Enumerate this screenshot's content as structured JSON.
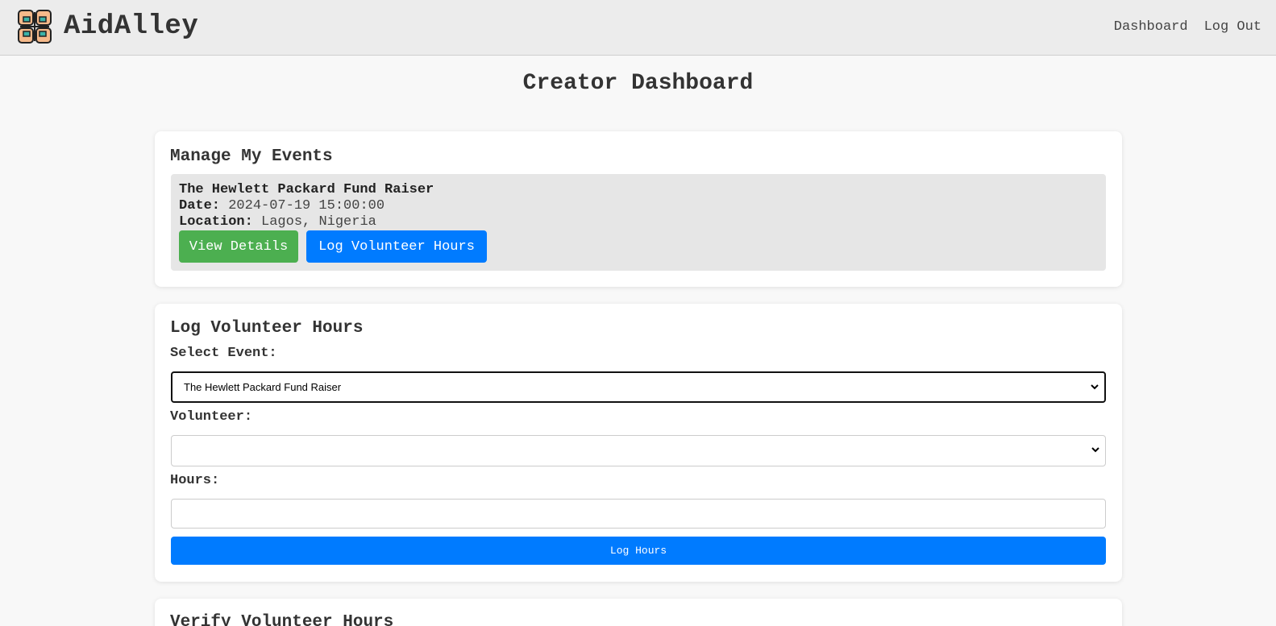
{
  "header": {
    "brand": "AidAlley",
    "nav": [
      {
        "label": "Dashboard"
      },
      {
        "label": "Log Out"
      }
    ]
  },
  "page_title": "Creator Dashboard",
  "manage_events": {
    "title": "Manage My Events",
    "event": {
      "name": "The Hewlett Packard Fund Raiser",
      "date_label": "Date:",
      "date": "2024-07-19 15:00:00",
      "location_label": "Location:",
      "location": "Lagos, Nigeria",
      "view_details": "View Details",
      "log_hours": "Log Volunteer Hours"
    }
  },
  "log_hours_form": {
    "title": "Log Volunteer Hours",
    "event_label": "Select Event:",
    "event_selected": "The Hewlett Packard Fund Raiser",
    "volunteer_label": "Volunteer:",
    "volunteer_selected": "",
    "hours_label": "Hours:",
    "hours_value": "",
    "submit": "Log Hours"
  },
  "verify_hours": {
    "title": "Verify Volunteer Hours"
  },
  "colors": {
    "green": "#4caf50",
    "blue": "#007bff",
    "header_bg": "#ececec"
  },
  "icons": {
    "logo": "hands-circle-logo-icon",
    "select_chevron": "chevron-down-icon"
  }
}
